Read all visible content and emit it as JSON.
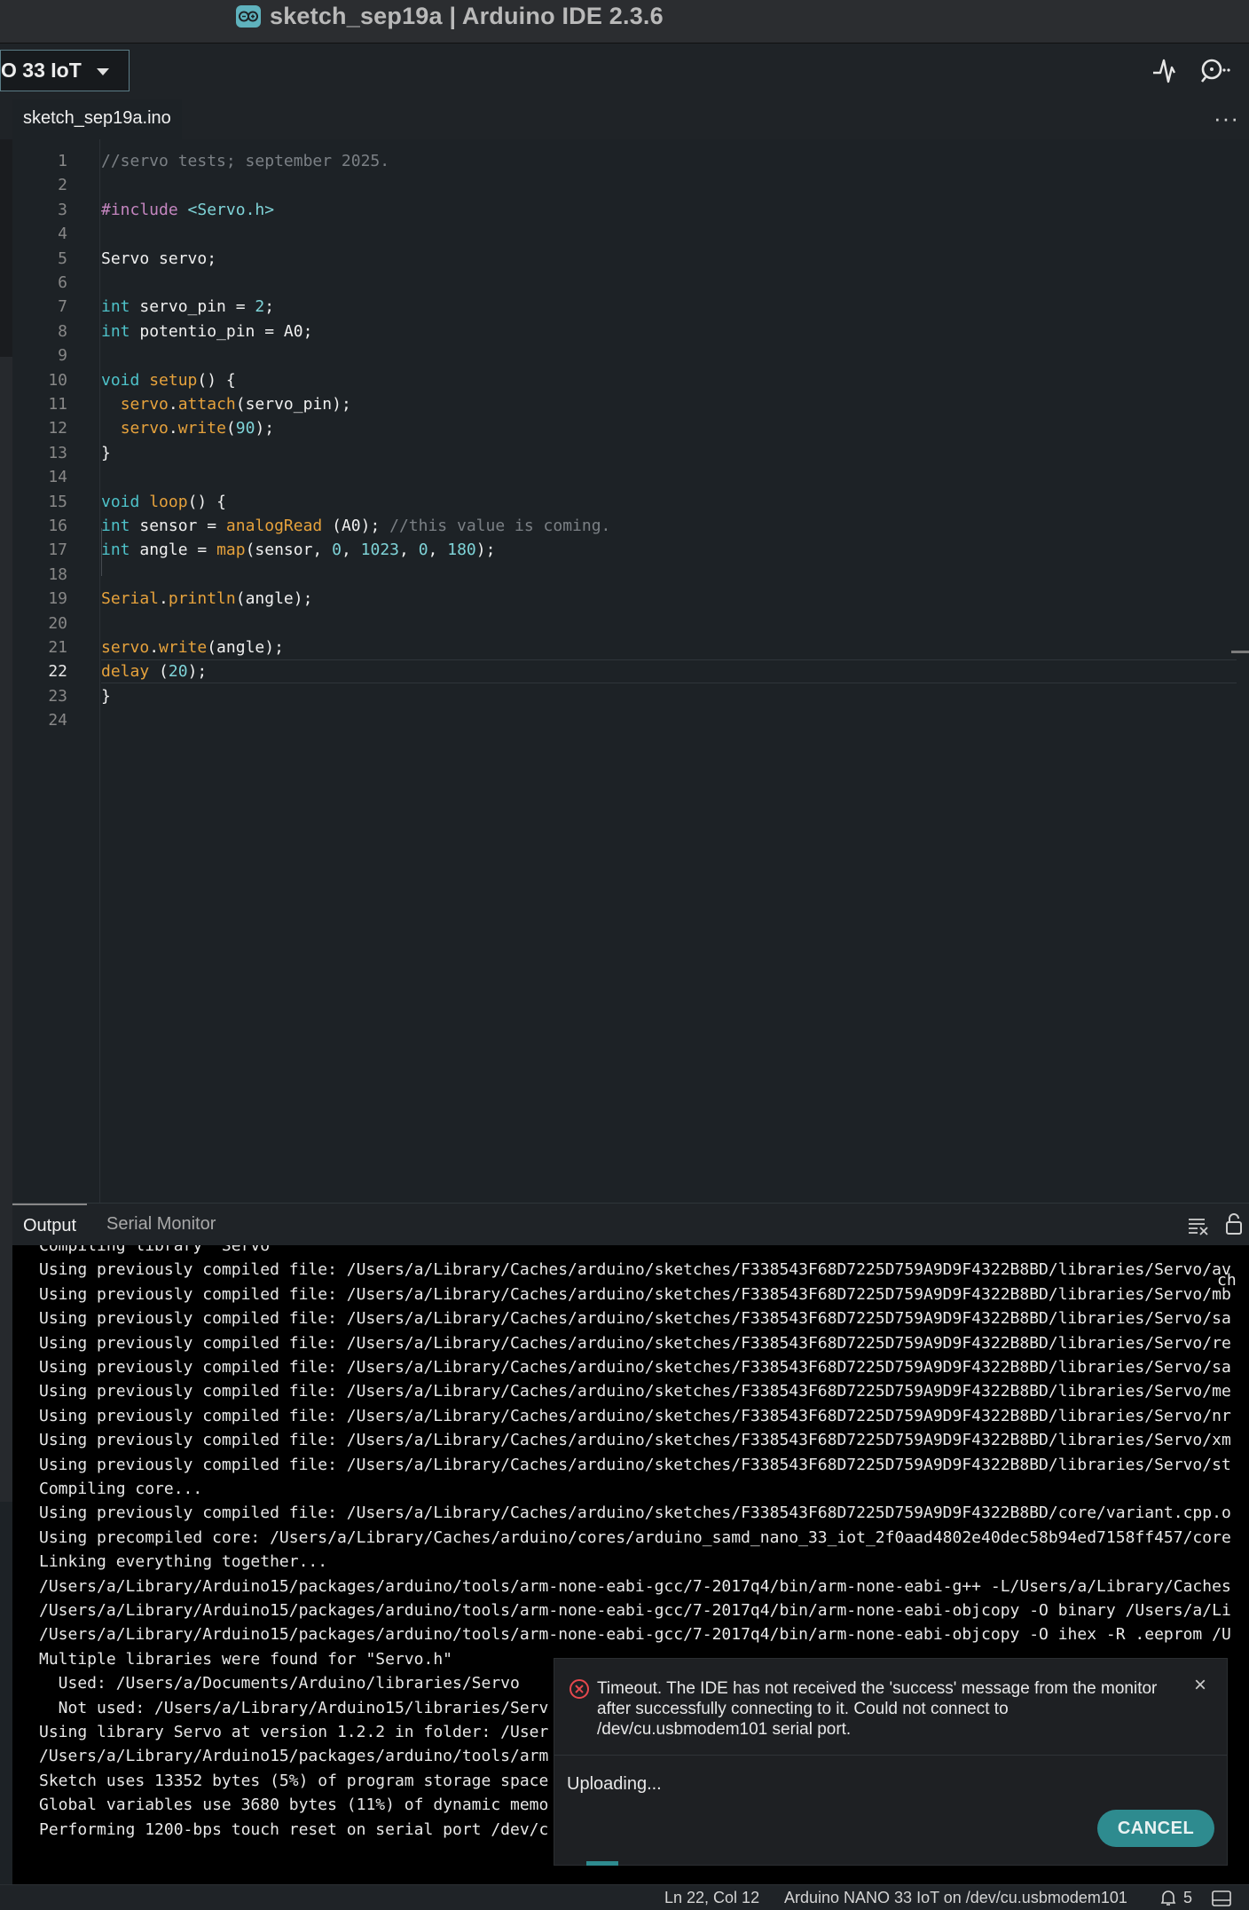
{
  "window": {
    "title": "sketch_sep19a | Arduino IDE 2.3.6"
  },
  "toolbar": {
    "board_label": "O 33 IoT",
    "icons": [
      "serial-plotter-icon",
      "serial-monitor-icon"
    ]
  },
  "tabs": {
    "file": "sketch_sep19a.ino",
    "more": "···"
  },
  "editor": {
    "active_line": 22,
    "lines": [
      "//servo tests; september 2025.",
      "",
      "#include <Servo.h>",
      "",
      "Servo servo;",
      "",
      "int servo_pin = 2;",
      "int potentio_pin = A0;",
      "",
      "void setup() {",
      "  servo.attach(servo_pin);",
      "  servo.write(90);",
      "}",
      "",
      "void loop() {",
      "int sensor = analogRead (A0); //this value is coming.",
      "int angle = map(sensor, 0, 1023, 0, 180);",
      "",
      "Serial.println(angle);",
      "",
      "servo.write(angle);",
      "delay (20);",
      "}",
      ""
    ]
  },
  "panel": {
    "tab_output": "Output",
    "tab_serial": "Serial Monitor",
    "output_lines": [
      "Compiling library \"Servo\"",
      "Using previously compiled file: /Users/a/Library/Caches/arduino/sketches/F338543F68D7225D759A9D9F4322B8BD/libraries/Servo/av",
      "Using previously compiled file: /Users/a/Library/Caches/arduino/sketches/F338543F68D7225D759A9D9F4322B8BD/libraries/Servo/mb",
      "Using previously compiled file: /Users/a/Library/Caches/arduino/sketches/F338543F68D7225D759A9D9F4322B8BD/libraries/Servo/sa",
      "Using previously compiled file: /Users/a/Library/Caches/arduino/sketches/F338543F68D7225D759A9D9F4322B8BD/libraries/Servo/re",
      "Using previously compiled file: /Users/a/Library/Caches/arduino/sketches/F338543F68D7225D759A9D9F4322B8BD/libraries/Servo/sa",
      "Using previously compiled file: /Users/a/Library/Caches/arduino/sketches/F338543F68D7225D759A9D9F4322B8BD/libraries/Servo/me",
      "Using previously compiled file: /Users/a/Library/Caches/arduino/sketches/F338543F68D7225D759A9D9F4322B8BD/libraries/Servo/nr",
      "Using previously compiled file: /Users/a/Library/Caches/arduino/sketches/F338543F68D7225D759A9D9F4322B8BD/libraries/Servo/xm",
      "Using previously compiled file: /Users/a/Library/Caches/arduino/sketches/F338543F68D7225D759A9D9F4322B8BD/libraries/Servo/st",
      "Compiling core...",
      "Using previously compiled file: /Users/a/Library/Caches/arduino/sketches/F338543F68D7225D759A9D9F4322B8BD/core/variant.cpp.o",
      "Using precompiled core: /Users/a/Library/Caches/arduino/cores/arduino_samd_nano_33_iot_2f0aad4802e40dec58b94ed7158ff457/core",
      "Linking everything together...",
      "/Users/a/Library/Arduino15/packages/arduino/tools/arm-none-eabi-gcc/7-2017q4/bin/arm-none-eabi-g++ -L/Users/a/Library/Caches",
      "/Users/a/Library/Arduino15/packages/arduino/tools/arm-none-eabi-gcc/7-2017q4/bin/arm-none-eabi-objcopy -O binary /Users/a/Li",
      "/Users/a/Library/Arduino15/packages/arduino/tools/arm-none-eabi-gcc/7-2017q4/bin/arm-none-eabi-objcopy -O ihex -R .eeprom /U",
      "Multiple libraries were found for \"Servo.h\"",
      "  Used: /Users/a/Documents/Arduino/libraries/Servo",
      "  Not used: /Users/a/Library/Arduino15/libraries/Serv",
      "Using library Servo at version 1.2.2 in folder: /User",
      "/Users/a/Library/Arduino15/packages/arduino/tools/arm",
      "Sketch uses 13352 bytes (5%) of program storage space",
      "Global variables use 3680 bytes (11%) of dynamic memo",
      "Performing 1200-bps touch reset on serial port /dev/c"
    ],
    "output_tail": "ch"
  },
  "notification": {
    "message": "Timeout. The IDE has not received the 'success' message from the monitor after successfully connecting to it. Could not connect to /dev/cu.usbmodem101 serial port.",
    "status": "Uploading...",
    "cancel_label": "CANCEL",
    "close_label": "×"
  },
  "statusbar": {
    "position": "Ln 22, Col 12",
    "board": "Arduino NANO 33 IoT on /dev/cu.usbmodem101",
    "notifications_count": "5"
  },
  "colors": {
    "accent": "#2e8b8f",
    "error": "#e5484d",
    "logo": "#5fb2bd"
  }
}
